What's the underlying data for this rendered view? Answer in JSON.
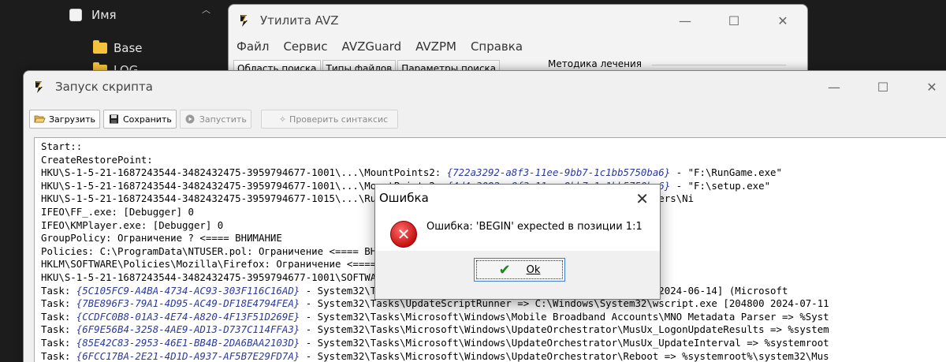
{
  "explorer": {
    "name_header": "Имя",
    "folders": [
      "Base",
      "LOG"
    ]
  },
  "avz_window": {
    "title": "Утилита AVZ",
    "menu": [
      "Файл",
      "Сервис",
      "AVZGuard",
      "AVZPM",
      "Справка"
    ],
    "tabs": [
      "Область поиска",
      "Типы файлов",
      "Параметры поиска"
    ],
    "group_label": "Методика лечения"
  },
  "script_window": {
    "title": "Запуск скрипта",
    "toolbar": {
      "load": "Загрузить",
      "save": "Сохранить",
      "run": "Запустить",
      "check": "Проверить синтаксис"
    },
    "code_lines": [
      [
        {
          "t": "Start::"
        }
      ],
      [
        {
          "t": "CreateRestorePoint:"
        }
      ],
      [
        {
          "t": "HKU\\S-1-5-21-1687243544-3482432475-3959794677-1001\\...\\MountPoints2: "
        },
        {
          "t": "{722a3292-a8f3-11ee-9bb7-1c1bb5750ba6}",
          "g": true
        },
        {
          "t": " - \"F:\\RunGame.exe\""
        }
      ],
      [
        {
          "t": "HKU\\S-1-5-21-1687243544-3482432475-3959794677-1001\\...\\MountPoints2: "
        },
        {
          "t": "{4d4a3092-a8f3-11ee-9bb7-1c1bb5750ba6}",
          "g": true
        },
        {
          "t": " - \"F:\\setup.exe\""
        }
      ],
      [
        {
          "t": "HKU\\S-1-5-21-1687243544-3482432475-3959794677-1015\\...\\Run: [OneDrive17782882BD6B071F990CB9C91] => \"C:\\Users\\Ni"
        }
      ],
      [
        {
          "t": "IFEO\\FF_.exe: [Debugger] 0"
        }
      ],
      [
        {
          "t": "IFEO\\KMPlayer.exe: [Debugger] 0"
        }
      ],
      [
        {
          "t": "GroupPolicy: Ограничение ? <==== ВНИМАНИЕ"
        }
      ],
      [
        {
          "t": "Policies: C:\\ProgramData\\NTUSER.pol: Ограничение <==== ВНИМАНИЕ"
        }
      ],
      [
        {
          "t": "HKLM\\SOFTWARE\\Policies\\Mozilla\\Firefox: Ограничение <==== ВНИМАНИЕ"
        }
      ],
      [
        {
          "t": "HKU\\S-1-5-21-1687243544-3482432475-3959794677-1001\\SOFTWARE\\Policies\\Google: Ограничение <==== ВНИМАНИЕ"
        }
      ],
      [
        {
          "t": "Task: "
        },
        {
          "t": "{5C105FC9-A4BA-4734-AC93-303F116C16AD}",
          "g": true
        },
        {
          "t": " - System32\\Tasks\\cmd => C:\\Windows\\System32\\cmd.exe [323584 2024-06-14] (Microsoft"
        }
      ],
      [
        {
          "t": "Task: "
        },
        {
          "t": "{7BE896F3-79A1-4D95-AC49-DF18E4794FEA}",
          "g": true
        },
        {
          "t": " - System32\\Tasks\\UpdateScriptRunner => C:\\Windows\\System32\\wscript.exe [204800 2024-07-11"
        }
      ],
      [
        {
          "t": "Task: "
        },
        {
          "t": "{CCDFC0B8-01A3-4E74-A820-4F13F51D269E}",
          "g": true
        },
        {
          "t": " - System32\\Tasks\\Microsoft\\Windows\\Mobile Broadband Accounts\\MNO Metadata Parser => %Syst"
        }
      ],
      [
        {
          "t": "Task: "
        },
        {
          "t": "{6F9E56B4-3258-4AE9-AD13-D737C114FFA3}",
          "g": true
        },
        {
          "t": " - System32\\Tasks\\Microsoft\\Windows\\UpdateOrchestrator\\MusUx_LogonUpdateResults => %system"
        }
      ],
      [
        {
          "t": "Task: "
        },
        {
          "t": "{85E42C83-2953-46E1-BB4B-2DA6BAA2103D}",
          "g": true
        },
        {
          "t": " - System32\\Tasks\\Microsoft\\Windows\\UpdateOrchestrator\\MusUx_UpdateInterval => %systemroot"
        }
      ],
      [
        {
          "t": "Task: "
        },
        {
          "t": "{6FCC17BA-2E21-4D1D-A937-AF5B7E29FD7A}",
          "g": true
        },
        {
          "t": " - System32\\Tasks\\Microsoft\\Windows\\UpdateOrchestrator\\Reboot => %systemroot%\\system32\\Mus"
        }
      ]
    ]
  },
  "dialog": {
    "title": "Ошибка",
    "message": "Ошибка: 'BEGIN' expected в позиции 1:1",
    "ok_label": "Ok"
  }
}
